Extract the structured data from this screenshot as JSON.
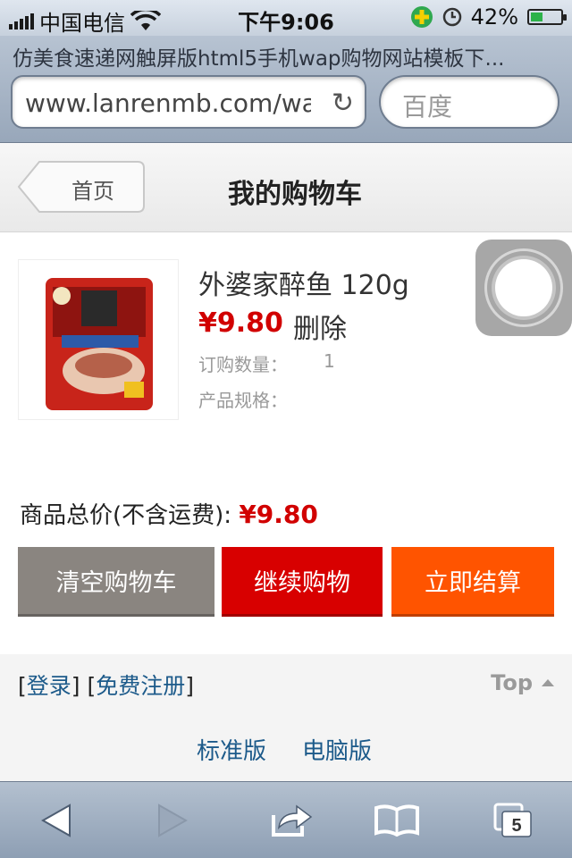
{
  "status": {
    "carrier": "中国电信",
    "time": "下午9:06",
    "battery": "42%",
    "battery_level": 0.42
  },
  "browser": {
    "page_title": "仿美食速递网触屏版html5手机wap购物网站模板下...",
    "url": "www.lanrenmb.com/wap",
    "search_placeholder": "百度",
    "tab_count": "5"
  },
  "header": {
    "back_label": "首页",
    "title": "我的购物车"
  },
  "cart": {
    "item": {
      "name": "外婆家醉鱼 120g",
      "price": "¥9.80",
      "delete_label": "删除",
      "qty_label": "订购数量：",
      "qty": "1",
      "spec_label": "产品规格："
    },
    "total_label": "商品总价(不含运费):",
    "total_value": "¥9.80"
  },
  "actions": {
    "clear": "清空购物车",
    "continue": "继续购物",
    "checkout": "立即结算"
  },
  "footer": {
    "login": "登录",
    "register": "免费注册",
    "top": "Top",
    "standard": "标准版",
    "desktop": "电脑版"
  }
}
